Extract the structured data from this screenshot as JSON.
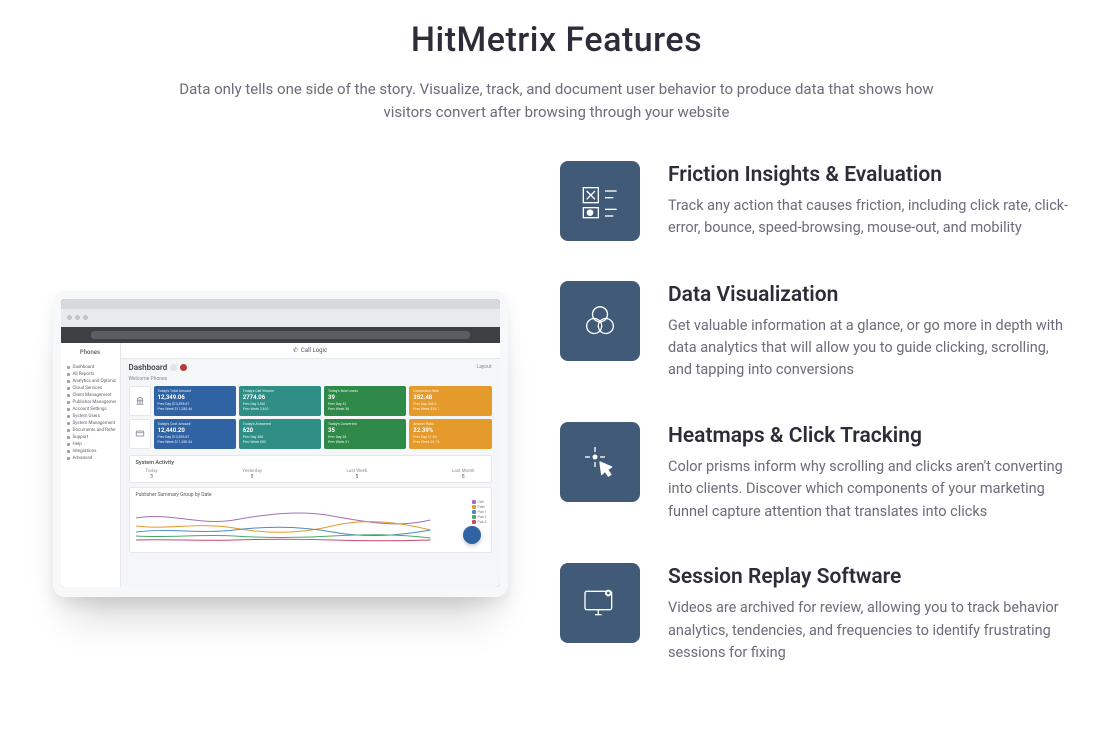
{
  "hero": {
    "title": "HitMetrix Features",
    "subtitle": "Data only tells one side of the story. Visualize, track, and document user behavior to produce data that shows how visitors convert after browsing through your website"
  },
  "features": [
    {
      "icon": "friction-icon",
      "title": "Friction Insights & Evaluation",
      "desc": "Track any action that causes friction, including click rate, click-error, bounce, speed-browsing, mouse-out, and mobility"
    },
    {
      "icon": "venn-icon",
      "title": "Data Visualization",
      "desc": "Get valuable information at a glance, or go more in depth with data analytics that will allow you to guide clicking, scrolling, and tapping into conversions"
    },
    {
      "icon": "click-target-icon",
      "title": "Heatmaps & Click Tracking",
      "desc": "Color prisms inform why scrolling and clicks aren't converting into clients. Discover which components of your marketing funnel capture attention that translates into clicks"
    },
    {
      "icon": "monitor-play-icon",
      "title": "Session Replay Software",
      "desc": "Videos are archived for review, allowing you to track behavior analytics, tendencies, and frequencies to identify frustrating sessions for fixing"
    }
  ],
  "mockup": {
    "app_name": "Call Logic",
    "sidebar_header": "Phones",
    "sidebar_items": [
      "Dashboard",
      "All Reports",
      "Analytics and Optimization",
      "Cloud Services",
      "Client Management",
      "Publisher Management",
      "Account Settings",
      "System Users",
      "System Management",
      "Documents and References",
      "Support",
      "Help",
      "Integrations",
      "Advanced"
    ],
    "dashboard_label": "Dashboard",
    "layout_label": "Layout",
    "welcome_label": "Welcome Phones",
    "kpi_rows": [
      [
        {
          "color": "blue",
          "big": "12,349.06",
          "lines": [
            "Today's Total Amount",
            "Prev Day $13,595.67",
            "Prev Week $11,280.44"
          ]
        },
        {
          "color": "teal",
          "big": "2774.06",
          "lines": [
            "Today's Call Volume",
            "Prev Day 2,561",
            "Prev Week 2,610"
          ]
        },
        {
          "color": "green",
          "big": "39",
          "lines": [
            "Today's New Leads",
            "Prev Day 42",
            "Prev Week 38"
          ]
        },
        {
          "color": "orange",
          "big": "352.48",
          "lines": [
            "Conversion Rate",
            "Prev Day 348.2",
            "Prev Week 355.1"
          ]
        }
      ],
      [
        {
          "color": "blue",
          "big": "12,440.20",
          "lines": [
            "Today's Cost Amount",
            "Prev Day $13,595.67",
            "Prev Week $11,280.44"
          ]
        },
        {
          "color": "teal",
          "big": "620",
          "lines": [
            "Today's Answered",
            "Prev Day 588",
            "Prev Week 602"
          ]
        },
        {
          "color": "green",
          "big": "35",
          "lines": [
            "Today's Converted",
            "Prev Day 33",
            "Prev Week 31"
          ]
        },
        {
          "color": "orange",
          "big": "22.39%",
          "lines": [
            "Answer Ratio",
            "Prev Day 21.8%",
            "Prev Week 22.1%"
          ]
        }
      ]
    ],
    "system_activity": {
      "title": "System Activity",
      "cols": [
        {
          "label": "Today",
          "value": "3"
        },
        {
          "label": "Yesterday",
          "value": "5"
        },
        {
          "label": "Last Week",
          "value": "5"
        },
        {
          "label": "Last Month",
          "value": "5"
        }
      ]
    },
    "chart": {
      "title": "Publisher Summary Group by Date",
      "legend": [
        "Call",
        "Paid",
        "Pub 1",
        "Pub 2",
        "Pub 3"
      ]
    }
  }
}
